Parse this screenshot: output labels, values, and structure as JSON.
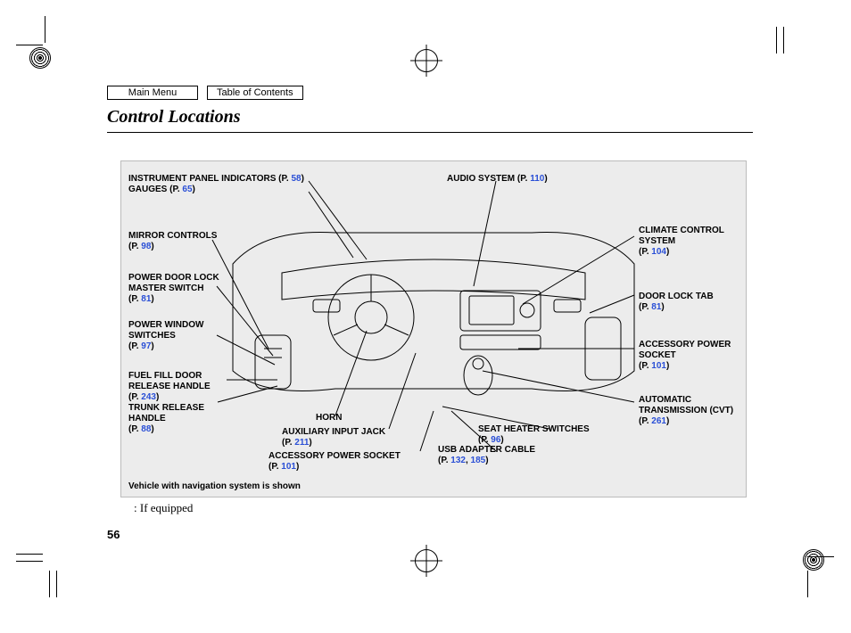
{
  "nav": {
    "main_menu": "Main Menu",
    "toc": "Table of Contents"
  },
  "title": "Control Locations",
  "callouts": {
    "instrument_panel": {
      "label": "INSTRUMENT PANEL INDICATORS",
      "page": "58"
    },
    "gauges": {
      "label": "GAUGES",
      "page": "65"
    },
    "audio": {
      "label": "AUDIO SYSTEM",
      "page": "110"
    },
    "mirror": {
      "label": "MIRROR CONTROLS",
      "page": "98"
    },
    "door_lock_master": {
      "label": "POWER DOOR LOCK MASTER SWITCH",
      "page": "81"
    },
    "power_window": {
      "label": "POWER WINDOW SWITCHES",
      "page": "97"
    },
    "fuel_fill": {
      "label": "FUEL FILL DOOR RELEASE HANDLE",
      "page": "243"
    },
    "trunk_release": {
      "label": "TRUNK RELEASE HANDLE",
      "page": "88"
    },
    "horn": {
      "label": "HORN"
    },
    "aux_jack": {
      "label": "AUXILIARY INPUT JACK",
      "page": "211"
    },
    "acc_socket_l": {
      "label": "ACCESSORY POWER SOCKET",
      "page": "101"
    },
    "usb": {
      "label": "USB ADAPTER CABLE",
      "page_a": "132",
      "page_b": "185"
    },
    "seat_heater": {
      "label": "SEAT HEATER SWITCHES",
      "page": "96"
    },
    "climate": {
      "label": "CLIMATE CONTROL SYSTEM",
      "page": "104"
    },
    "door_lock_tab": {
      "label": "DOOR LOCK TAB",
      "page": "81"
    },
    "acc_socket_r": {
      "label": "ACCESSORY POWER SOCKET",
      "page": "101"
    },
    "auto_trans": {
      "label": "AUTOMATIC TRANSMISSION (CVT)",
      "page": "261"
    }
  },
  "footnote": "Vehicle with navigation system is shown",
  "if_equipped": ":  If equipped",
  "page_number": "56",
  "page_prefix": "(P. ",
  "page_suffix": ")"
}
